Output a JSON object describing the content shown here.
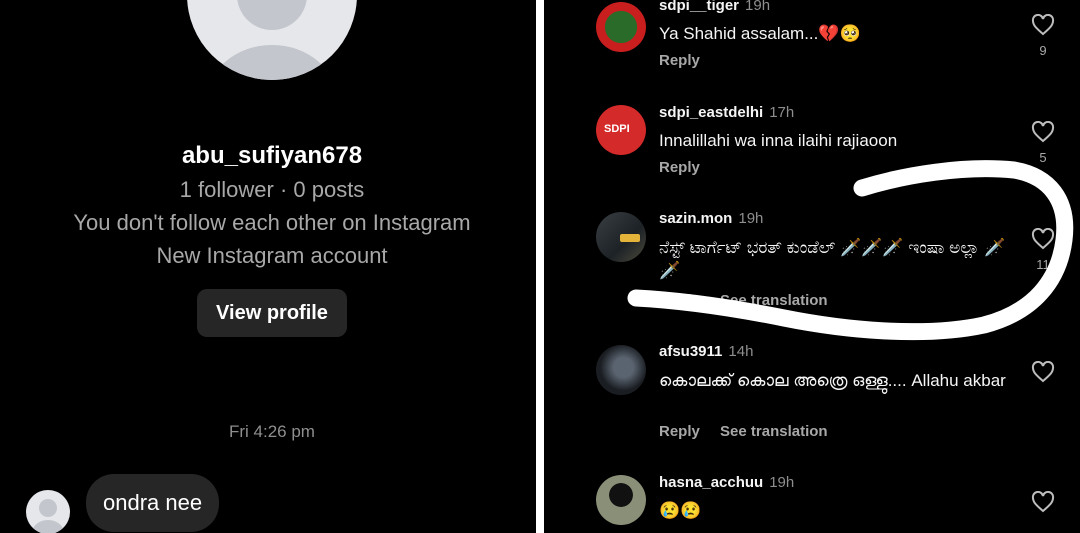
{
  "dm": {
    "username": "abu_sufiyan678",
    "stats": "1 follower · 0 posts",
    "relation": "You don't follow each other on Instagram",
    "account_note": "New Instagram account",
    "view_profile": "View profile",
    "timestamp": "Fri 4:26 pm",
    "message": "ondra nee"
  },
  "comments": [
    {
      "user": "sdpi__tiger",
      "time": "19h",
      "text": "Ya Shahid assalam...💔🥺",
      "actions": [
        "Reply"
      ],
      "likes": "9"
    },
    {
      "user": "sdpi_eastdelhi",
      "time": "17h",
      "text": "Innalillahi wa inna ilaihi rajiaoon",
      "actions": [
        "Reply"
      ],
      "likes": "5"
    },
    {
      "user": "sazin.mon",
      "time": "19h",
      "text": "ನೆಸ್ಟ್ ಟಾರ್ಗೆಟ್ ಭರತ್ ಕುಂಡೆಲ್ 🗡️🗡️🗡️ ಇಂಷಾ ಅಲ್ಲಾ 🗡️🗡️",
      "actions": [
        "Reply",
        "See translation"
      ],
      "likes": "11"
    },
    {
      "user": "afsu3911",
      "time": "14h",
      "text": "കൊലക്ക് കൊല അത്രെ ഒള്ളു.... Allahu akbar",
      "actions": [
        "Reply",
        "See translation"
      ],
      "likes": ""
    },
    {
      "user": "hasna_acchuu",
      "time": "19h",
      "text": "😢😢",
      "actions": [],
      "likes": ""
    }
  ],
  "colors": {
    "background": "#000000",
    "bubble": "#262626",
    "secondary_text": "#a8a8a8",
    "annotation_stroke": "#ffffff"
  },
  "icons": [
    "default-avatar-icon",
    "heart-icon"
  ]
}
